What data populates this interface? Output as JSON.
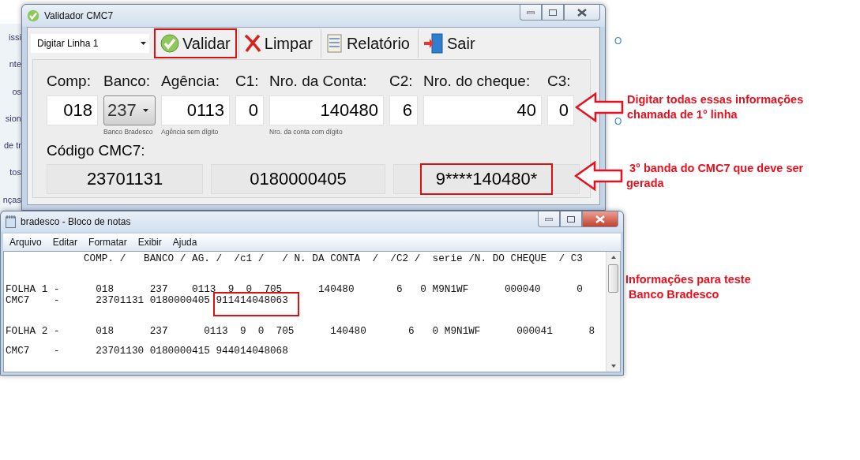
{
  "background_page": {
    "sidebar_fragments": [
      "issi",
      "nte",
      "os",
      "sion",
      "de tr",
      "tos",
      "nças"
    ],
    "link_fragments": [
      "O",
      "O"
    ]
  },
  "validator_window": {
    "title": "Validador CMC7",
    "toolbar": {
      "mode_select": {
        "value": "Digitar Linha 1"
      },
      "buttons": [
        {
          "kind": "validate",
          "label": "Validar",
          "highlighted": true
        },
        {
          "kind": "clear",
          "label": "Limpar",
          "highlighted": false
        },
        {
          "kind": "report",
          "label": "Relatório",
          "highlighted": false
        },
        {
          "kind": "exit",
          "label": "Sair",
          "highlighted": false
        }
      ]
    },
    "fields": [
      {
        "kind": "text",
        "label": "Comp:",
        "value": "018"
      },
      {
        "kind": "dropdown",
        "label": "Banco:",
        "value": "237",
        "hint": "Banco Bradesco"
      },
      {
        "kind": "text",
        "label": "Agência:",
        "value": "0113",
        "hint": "Agência sem dígito"
      },
      {
        "kind": "text",
        "label": "C1:",
        "value": "0"
      },
      {
        "kind": "text",
        "label": "Nro. da Conta:",
        "value": "140480",
        "hint": "Nro. da conta com dígito"
      },
      {
        "kind": "text",
        "label": "C2:",
        "value": "6"
      },
      {
        "kind": "text",
        "label": "Nro. do cheque:",
        "value": "40"
      },
      {
        "kind": "text",
        "label": "C3:",
        "value": "0"
      }
    ],
    "cmc7_label": "Código CMC7:",
    "cmc7_bands": [
      {
        "value": "23701131",
        "highlighted": false
      },
      {
        "value": "0180000405",
        "highlighted": false
      },
      {
        "value": "9****140480*",
        "highlighted": true
      }
    ]
  },
  "notepad_window": {
    "title": "bradesco - Bloco de notas",
    "menu": [
      "Arquivo",
      "Editar",
      "Formatar",
      "Exibir",
      "Ajuda"
    ],
    "lines": [
      {
        "kind": "header",
        "text": "             COMP. /   BANCO / AG. /  /c1 /   / N. DA CONTA  /  /C2 /  serie /N. DO CHEQUE  / C3"
      },
      {
        "kind": "folha",
        "text": "FOLHA 1 -      018      237    0113  9  0  705      140480       6   0 M9N1WF      000040      0"
      },
      {
        "kind": "cmc7",
        "text": "CMC7    -      23701131 0180000405 ",
        "highlight": "911414048063"
      },
      {
        "kind": "folha",
        "text": "FOLHA 2 -      018      237      0113  9  0  705      140480       6   0 M9N1WF      000041      8"
      },
      {
        "kind": "cmc7",
        "text": "CMC7    -      23701130 0180000415 944014048068"
      }
    ]
  },
  "annotations": [
    {
      "kind": "arrow",
      "lines": [
        "Digitar todas essas informações",
        "chamada de 1° linha"
      ]
    },
    {
      "kind": "arrow",
      "lines": [
        " 3° banda do CMC7 que deve ser",
        "gerada"
      ]
    },
    {
      "kind": "plain",
      "lines": [
        "Informações para teste",
        " Banco Bradesco"
      ]
    }
  ]
}
